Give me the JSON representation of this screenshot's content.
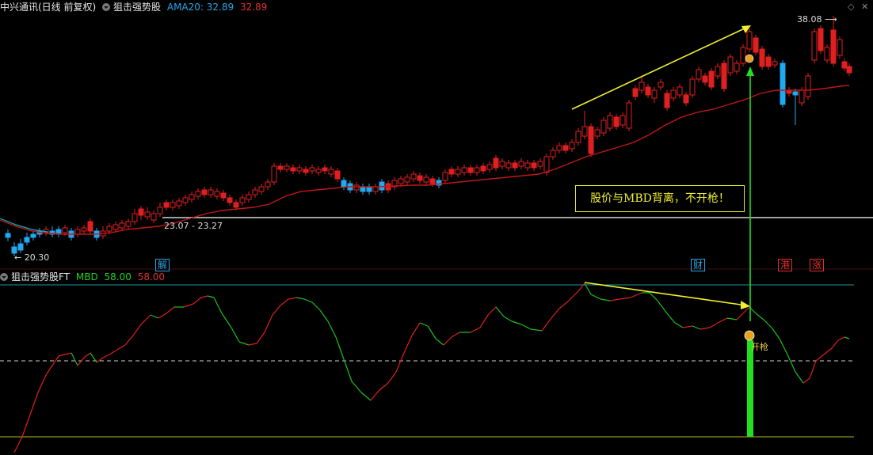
{
  "main_header": {
    "title": "中兴通讯(日线 前复权)",
    "indicator": "狙击强势股",
    "ama_label": "AMA20: 32.89",
    "ama_value2": "32.89"
  },
  "sub_header": {
    "indicator": "狙击强势股FT",
    "mbd_label": "MBD",
    "mbd_value1": "58.00",
    "mbd_value2": "58.00"
  },
  "price_labels": {
    "high": "38.08",
    "low": "20.30",
    "range": "23.07 - 23.27"
  },
  "event_tags": [
    {
      "text": "解",
      "color": "#2aa5e6"
    },
    {
      "text": "财",
      "color": "#2aa5e6"
    },
    {
      "text": "港",
      "color": "#e03030"
    },
    {
      "text": "涨",
      "color": "#e03030"
    }
  ],
  "annotations": {
    "divergence_text": "股价与MBD背离，不开枪！",
    "fire_text": "开枪"
  },
  "colors": {
    "up": "#e02020",
    "down_blue": "#21a8f0",
    "ma_line": "#c01818",
    "indicator_up": "#e02020",
    "indicator_down": "#20c020",
    "arrow_yellow": "#f0f030",
    "arrow_green": "#20e020",
    "cyan_line": "#1a9a9a",
    "yellow_line": "#b8b820"
  },
  "icons": {
    "window_controls": [
      "restore-icon",
      "close-icon"
    ]
  }
}
